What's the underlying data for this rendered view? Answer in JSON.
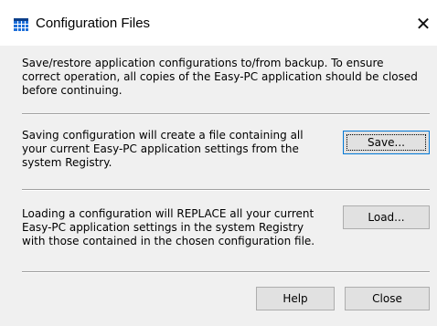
{
  "window": {
    "title": "Configuration Files",
    "icon": "grid-app-icon",
    "close_glyph": "✕"
  },
  "intro_text": [
    "Save/restore application configurations to/from backup. To ensure",
    "correct operation, all copies of the Easy-PC application should be closed",
    "before continuing."
  ],
  "save_section": {
    "text": [
      "Saving configuration will create a file containing all",
      "your current Easy-PC application settings from the",
      "system Registry."
    ],
    "button_label": "Save..."
  },
  "load_section": {
    "text": [
      "Loading a configuration will REPLACE all your current",
      "Easy-PC application settings in the system Registry",
      "with those contained in the chosen configuration file."
    ],
    "button_label": "Load..."
  },
  "footer": {
    "help_label": "Help",
    "close_label": "Close"
  },
  "colors": {
    "dialog_bg": "#f0f0f0",
    "titlebar_bg": "#ffffff",
    "button_bg": "#e1e1e1",
    "focus_border": "#0078d7",
    "icon_blue": "#1e6fd9"
  }
}
